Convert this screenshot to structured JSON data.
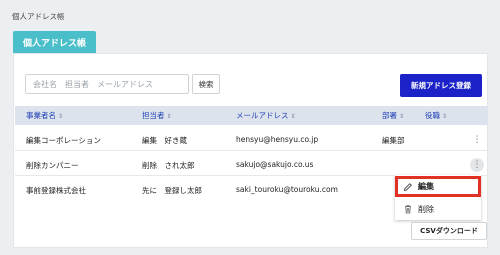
{
  "page": {
    "title": "個人アドレス帳"
  },
  "tab": {
    "label": "個人アドレス帳"
  },
  "search": {
    "placeholder": "会社名　担当者　メールアドレス",
    "value": "",
    "button_label": "検索"
  },
  "actions": {
    "new_label": "新規アドレス登録",
    "csv_label": "CSVダウンロード"
  },
  "table": {
    "columns": [
      {
        "label": "事業者名",
        "sort": "⇕"
      },
      {
        "label": "担当者",
        "sort": "⇕"
      },
      {
        "label": "メールアドレス",
        "sort": "⇕"
      },
      {
        "label": "部署",
        "sort": "⇕"
      },
      {
        "label": "役職",
        "sort": "⇕"
      }
    ],
    "rows": [
      {
        "company": "編集コーポレーション",
        "person": "編集　好き蔵",
        "email": "hensyu@hensyu.co.jp",
        "dept": "編集部",
        "title": "",
        "menu": "⋮"
      },
      {
        "company": "削除カンパニー",
        "person": "削除　され太郎",
        "email": "sakujo@sakujo.co.us",
        "dept": "",
        "title": "",
        "menu": "⋮"
      },
      {
        "company": "事前登録株式会社",
        "person": "先に　登録し太郎",
        "email": "saki_touroku@touroku.com",
        "dept": "",
        "title": "",
        "menu": ""
      }
    ]
  },
  "context_menu": {
    "items": [
      {
        "label": "編集",
        "icon": "pencil-icon",
        "highlighted": true
      },
      {
        "label": "削除",
        "icon": "trash-icon",
        "highlighted": false
      }
    ]
  },
  "colors": {
    "accent": "#4bbfc9",
    "primary": "#1a22c8",
    "highlight": "#e03124",
    "header_bg": "#dde3ed"
  }
}
